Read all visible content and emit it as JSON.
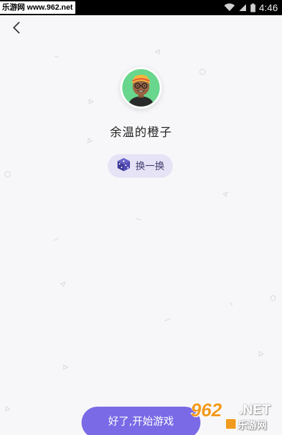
{
  "status_bar": {
    "watermark_text": "乐游网 www.962.net",
    "time": "4:46",
    "icons": [
      "wifi-icon",
      "signal-icon",
      "battery-icon"
    ]
  },
  "nav": {
    "back_icon": "chevron-left-icon"
  },
  "profile": {
    "nickname": "余温的橙子",
    "avatar_icon": "cartoon-avatar-icon"
  },
  "shuffle": {
    "icon": "dice-icon",
    "label": "换一换"
  },
  "start_button": {
    "label": "好了,开始游戏"
  },
  "watermark": {
    "number": "962",
    "suffix": ".NET",
    "name": "乐游网"
  },
  "colors": {
    "background": "#f7f7f9",
    "accent": "#7a6ae6",
    "shuffle_bg": "#e6e3f6",
    "avatar_bg": "#68d68c"
  }
}
